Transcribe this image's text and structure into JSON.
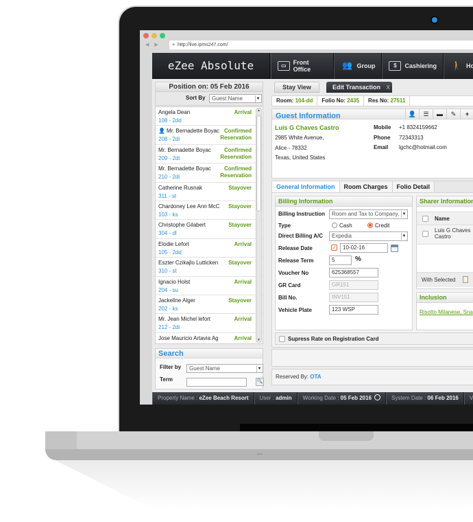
{
  "browser": {
    "url": "http://live.ipms247.com/"
  },
  "app": {
    "brand": "eZee Absolute",
    "nav": [
      {
        "label": "Front Office",
        "icon": "briefcase-icon"
      },
      {
        "label": "Group",
        "icon": "group-icon"
      },
      {
        "label": "Cashiering",
        "icon": "cash-icon"
      },
      {
        "label": "Ho",
        "icon": "housekeeping-icon"
      }
    ]
  },
  "left_panel": {
    "position_label": "Position on: 05 Feb 2016",
    "sort_by_label": "Sort By",
    "sort_by_value": "Guest Name",
    "guests": [
      {
        "name": "Angela Dean",
        "room": "108 - 2dd",
        "status": "Arrival",
        "status2": ""
      },
      {
        "name": "Mr. Bernadette Boyac",
        "room": "208 - 2di",
        "status": "Confirmed",
        "status2": "Reservation",
        "has_icon": true
      },
      {
        "name": "Mr. Bernadette Boyac",
        "room": "209 - 2di",
        "status": "Confirmed",
        "status2": "Reservation"
      },
      {
        "name": "Mr. Bernadette Boyac",
        "room": "210 - 2di",
        "status": "Confirmed",
        "status2": "Reservation"
      },
      {
        "name": "Catherine Rusnak",
        "room": "311 - st",
        "status": "Stayover",
        "status2": ""
      },
      {
        "name": "Chardoney Lee Ann McC",
        "room": "103 - ks",
        "status": "Stayover",
        "status2": ""
      },
      {
        "name": "Christophe Gilabert",
        "room": "304 - dl",
        "status": "Stayover",
        "status2": ""
      },
      {
        "name": "Elodie Lefort",
        "room": "105 - 2dd",
        "status": "Arrival",
        "status2": ""
      },
      {
        "name": "Eszter Czikajlo Lutticken",
        "room": "310 - st",
        "status": "Stayover",
        "status2": ""
      },
      {
        "name": "Ignacio Holst",
        "room": "204 - su",
        "status": "Arrival",
        "status2": ""
      },
      {
        "name": "Jackeline Alger",
        "room": "202 - ks",
        "status": "Stayover",
        "status2": ""
      },
      {
        "name": "Mr. Jean Michel lefort",
        "room": "212 - 2di",
        "status": "Arrival",
        "status2": ""
      },
      {
        "name": "Jose Mauricio Artavia Ag",
        "room": "",
        "status": "Arrival",
        "status2": ""
      }
    ],
    "search": {
      "title": "Search",
      "filter_label": "Filter by",
      "filter_value": "Guest Name",
      "term_label": "Term",
      "term_value": ""
    }
  },
  "right_panel": {
    "tabs": {
      "stay_view": "Stay View",
      "edit_transaction": "Edit Transaction",
      "close": "X"
    },
    "info": {
      "room_label": "Room:",
      "room_value": "104-dd",
      "folio_label": "Folio No:",
      "folio_value": "2435",
      "res_label": "Res No:",
      "res_value": "27511"
    },
    "guest_info": {
      "title": "Guest Information",
      "name": "Luis G Chaves Castro",
      "address": [
        "2985 White Avenue,",
        "Alice - 78332",
        "Texas, United States"
      ],
      "mobile_label": "Mobile",
      "mobile": "+1 8324159662",
      "phone_label": "Phone",
      "phone": "72343313",
      "email_label": "Email",
      "email": "lgchc@hotmail.com",
      "tools": [
        "person-icon",
        "list-icon",
        "card-icon",
        "pencil-icon",
        "plus-icon"
      ]
    },
    "subtabs": [
      "General Information",
      "Room Charges",
      "Folio Detail"
    ],
    "billing": {
      "title": "Billing Information",
      "billing_instruction_label": "Billing Instruction",
      "billing_instruction_value": "Room and Tax to Company,",
      "type_label": "Type",
      "type_options": [
        "Cash",
        "Credit"
      ],
      "type_selected": "Credit",
      "direct_billing_label": "Direct Billing A/C",
      "direct_billing_value": "Expedia",
      "release_date_label": "Release Date",
      "release_date_checked": true,
      "release_date_value": "10-02-16",
      "release_term_label": "Release Term",
      "release_term_value": "5",
      "release_term_unit": "%",
      "voucher_label": "Voucher No",
      "voucher_value": "625368557",
      "gr_card_label": "GR Card",
      "gr_card_value": "GR151",
      "bill_no_label": "Bill No.",
      "bill_no_value": "INV151",
      "vehicle_label": "Vehicle Plate",
      "vehicle_value": "123 WSP"
    },
    "sharer": {
      "title": "Sharer Information",
      "name_header": "Name",
      "rows": [
        "Luis G Chaves Castro"
      ],
      "with_selected": "With Selected"
    },
    "inclusion": {
      "title": "Inclusion",
      "items": "Risotto Milanese, Sna"
    },
    "suppress_label": "Supress Rate on Registration Card",
    "reserved_label": "Reserved By:",
    "reserved_value": "OTA"
  },
  "statusbar": {
    "property_label": "Property Name :",
    "property_value": "eZee Beach Resort",
    "user_label": "User :",
    "user_value": "admin",
    "working_label": "Working Date :",
    "working_value": "05 Feb 2016",
    "system_label": "System Date :",
    "system_value": "06 Feb 2016",
    "version_label": "Version"
  }
}
